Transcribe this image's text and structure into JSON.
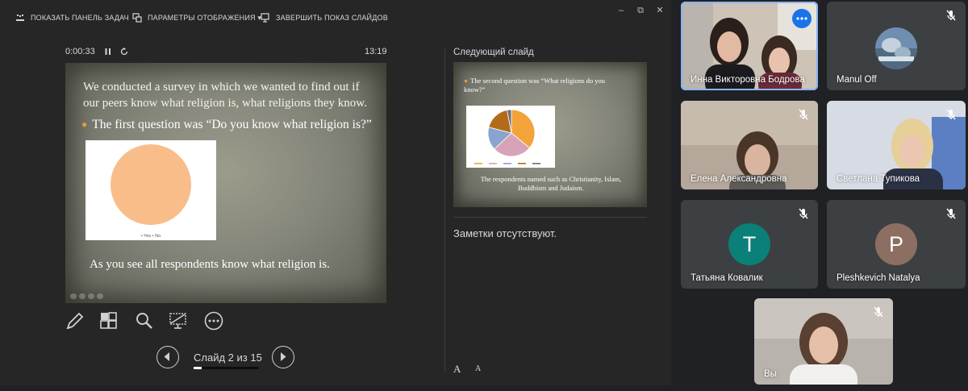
{
  "toolbar": {
    "show_taskbar": "ПОКАЗАТЬ ПАНЕЛЬ ЗАДАЧ",
    "display_settings": "ПАРАМЕТРЫ ОТОБРАЖЕНИЯ ▾",
    "end_slideshow": "ЗАВЕРШИТЬ ПОКАЗ СЛАЙДОВ"
  },
  "window_controls": {
    "minimize": "–",
    "restore": "⧉",
    "close": "✕"
  },
  "timer": {
    "elapsed": "0:00:33",
    "clock": "13:19"
  },
  "current_slide": {
    "intro": "We conducted a survey in which we wanted to find out if our peers know what religion is, what religions they know.",
    "bullet": "The first question was “Do you know what religion is?”",
    "chart_legend": "• Yes  • No",
    "conclusion": "As you see all respondents know what religion is."
  },
  "chart_data": [
    {
      "type": "pie",
      "categories": [
        "Yes",
        "No"
      ],
      "values": [
        100,
        0
      ],
      "colors": [
        "#f9bd8a",
        "#7fa7d9"
      ],
      "legend": "bottom"
    },
    {
      "type": "pie",
      "categories": [
        "",
        "",
        "",
        "",
        ""
      ],
      "values": [
        36,
        27,
        16,
        18,
        3
      ],
      "colors": [
        "#f2a33a",
        "#d7a3b6",
        "#8aa3cf",
        "#b46b19",
        "#6f6f6f"
      ],
      "legend": "bottom"
    }
  ],
  "slide_nav": {
    "counter": "Слайд 2 из 15",
    "progress": 0.13
  },
  "next_slide": {
    "label": "Следующий слайд",
    "question": "The second question was “What religions do you know?”",
    "conclusion": "The respondents named such as Christianity, Islam, Buddhism and Judaism."
  },
  "notes": {
    "text": "Заметки отсутствуют."
  },
  "font_buttons": {
    "increase": "A",
    "decrease": "A"
  },
  "icons": {
    "pen": "pen-icon",
    "slides": "all-slides-icon",
    "zoom": "zoom-icon",
    "screen": "black-screen-icon",
    "more": "more-options-icon"
  },
  "participants": [
    {
      "name": "Инна Викторовна Бодрова",
      "type": "video",
      "muted": false,
      "active": true
    },
    {
      "name": "Manul Off",
      "type": "avatar-image",
      "muted": true
    },
    {
      "name": "Елена Александровна",
      "type": "video",
      "muted": true
    },
    {
      "name": "Светлана Тупикова",
      "type": "video",
      "muted": true
    },
    {
      "name": "Татьяна Ковалик",
      "type": "letter",
      "letter": "T",
      "color": "#0b8078",
      "muted": true
    },
    {
      "name": "Pleshkevich Natalya",
      "type": "letter",
      "letter": "P",
      "color": "#8d6e63",
      "muted": true
    },
    {
      "name": "Вы",
      "type": "video",
      "muted": true
    }
  ]
}
